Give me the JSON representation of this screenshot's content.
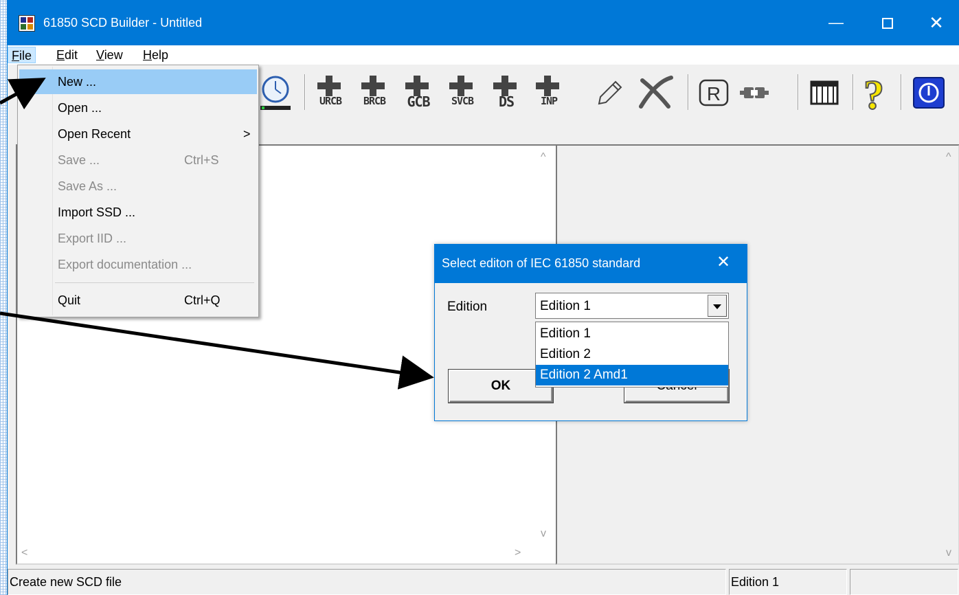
{
  "window": {
    "title": "61850 SCD Builder - Untitled",
    "minimize_glyph": "—",
    "close_glyph": "✕"
  },
  "menubar": {
    "file": "File",
    "edit": "Edit",
    "view": "View",
    "help": "Help",
    "file_ul": "F",
    "file_rest": "ile",
    "edit_ul": "E",
    "edit_rest": "dit",
    "view_ul": "V",
    "view_rest": "iew",
    "help_ul": "H",
    "help_rest": "elp"
  },
  "file_menu": {
    "items": [
      {
        "label": "New ...",
        "accel": "",
        "enabled": true,
        "highlighted": true
      },
      {
        "label": "Open ...",
        "accel": "",
        "enabled": true
      },
      {
        "label": "Open Recent",
        "accel": "",
        "enabled": true,
        "submenu_arrow": ">"
      },
      {
        "label": "Save ...",
        "accel": "Ctrl+S",
        "enabled": false
      },
      {
        "label": "Save As ...",
        "accel": "",
        "enabled": false
      },
      {
        "label": "Import SSD ...",
        "accel": "",
        "enabled": true
      },
      {
        "label": "Export IID ...",
        "accel": "",
        "enabled": false
      },
      {
        "label": "Export documentation ...",
        "accel": "",
        "enabled": false
      },
      {
        "label": "Quit",
        "accel": "Ctrl+Q",
        "enabled": true
      }
    ]
  },
  "toolbar": {
    "buttons": [
      {
        "name": "clock-icon"
      },
      {
        "name": "add-urcb-icon",
        "label": "URCB"
      },
      {
        "name": "add-brcb-icon",
        "label": "BRCB"
      },
      {
        "name": "add-gcb-icon",
        "label": "GCB"
      },
      {
        "name": "add-svcb-icon",
        "label": "SVCB"
      },
      {
        "name": "add-ds-icon",
        "label": "DS"
      },
      {
        "name": "add-inp-icon",
        "label": "INP"
      },
      {
        "name": "pencil-icon"
      },
      {
        "name": "delete-x-icon"
      },
      {
        "name": "registered-r-icon",
        "label": "R"
      },
      {
        "name": "plug-icon"
      },
      {
        "name": "table-icon"
      },
      {
        "name": "help-question-icon",
        "label": "?"
      },
      {
        "name": "power-icon"
      }
    ]
  },
  "dialog": {
    "title": "Select editon of IEC 61850 standard",
    "close_glyph": "✕",
    "edition_label": "Edition",
    "combo_value": "Edition 1",
    "options": [
      "Edition 1",
      "Edition 2",
      "Edition 2 Amd1"
    ],
    "selected_option_index": 2,
    "ok_label": "OK",
    "cancel_label": "Cancel"
  },
  "panes": {
    "left_scroll_up": "^",
    "left_scroll_down": "v",
    "left_scroll_left": "<",
    "left_scroll_right": ">",
    "right_scroll_up": "^",
    "right_scroll_down": "v"
  },
  "statusbar": {
    "message": "Create new SCD file",
    "edition": "Edition 1",
    "extra": ""
  },
  "colors": {
    "titlebar": "#0078d7",
    "menu_highlight": "#99ccf6",
    "selection": "#0078d7"
  }
}
